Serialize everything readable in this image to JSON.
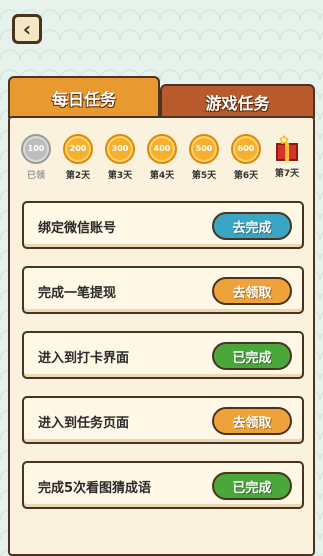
{
  "nav": {
    "back_icon": "chevron-left-icon",
    "back_glyph": "‹"
  },
  "tabs": {
    "daily": "每日任务",
    "game": "游戏任务"
  },
  "days": [
    {
      "coin": "100",
      "label": "已领",
      "claimed": true
    },
    {
      "coin": "200",
      "label": "第2天"
    },
    {
      "coin": "300",
      "label": "第3天"
    },
    {
      "coin": "400",
      "label": "第4天"
    },
    {
      "coin": "500",
      "label": "第5天"
    },
    {
      "coin": "600",
      "label": "第6天"
    },
    {
      "coin": "",
      "label": "第7天",
      "icon": "gift-box-icon"
    }
  ],
  "tasks": [
    {
      "label": "绑定微信账号",
      "button": "去完成",
      "color": "#3aa6c4"
    },
    {
      "label": "完成一笔提现",
      "button": "去领取",
      "color": "#f0a23a"
    },
    {
      "label": "进入到打卡界面",
      "button": "已完成",
      "color": "#4aa83a"
    },
    {
      "label": "进入到任务页面",
      "button": "去领取",
      "color": "#f0a23a"
    },
    {
      "label": "完成5次看图猜成语",
      "button": "已完成",
      "color": "#4aa83a"
    }
  ],
  "colors": {
    "tab_active": "#e89a31",
    "tab_inactive": "#b85a2c",
    "panel_bg": "#fbf2dd",
    "border": "#4a3320"
  }
}
